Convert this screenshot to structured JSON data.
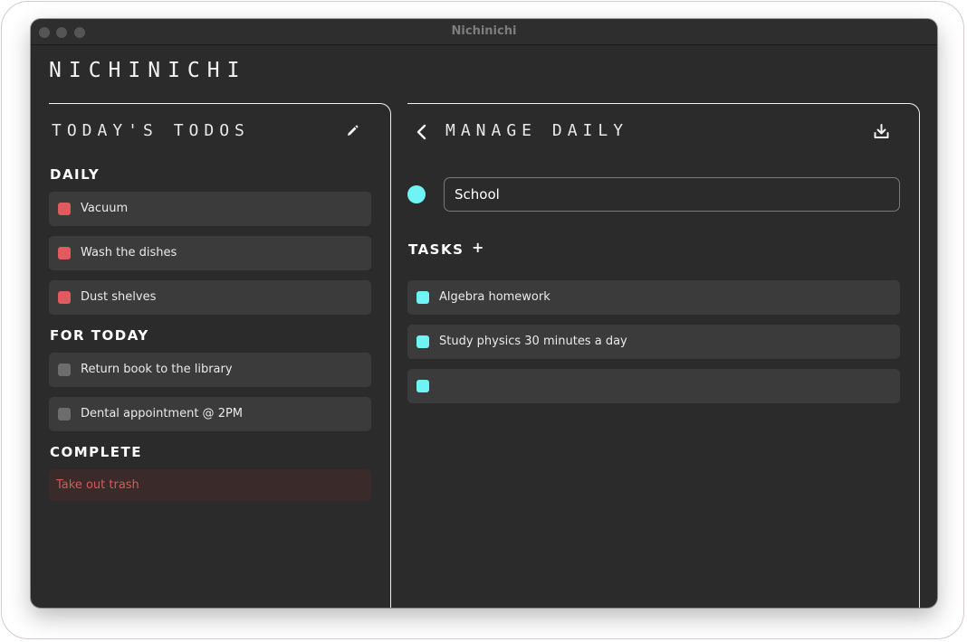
{
  "window": {
    "title": "Nichinichi"
  },
  "app": {
    "brand": "NICHINICHI"
  },
  "left": {
    "title": "TODAY'S TODOS",
    "sections": {
      "daily": {
        "label": "DAILY",
        "items": [
          "Vacuum",
          "Wash the dishes",
          "Dust shelves"
        ],
        "color": "#e05a5e"
      },
      "today": {
        "label": "FOR TODAY",
        "items": [
          "Return book to the library",
          "Dental appointment @ 2PM"
        ],
        "color": "#6d6d6d"
      },
      "complete": {
        "label": "COMPLETE",
        "items": [
          "Take out trash"
        ],
        "color": "#d8595b"
      }
    }
  },
  "right": {
    "title": "MANAGE DAILY",
    "group": {
      "name": "School",
      "color": "#6ff3f5"
    },
    "tasks_label": "TASKS",
    "add_glyph": "+",
    "tasks": [
      "Algebra homework",
      "Study physics 30 minutes a day",
      ""
    ]
  },
  "icons": {
    "edit": "pencil-icon",
    "back": "chevron-left-icon",
    "export": "download-icon",
    "add": "plus-icon"
  }
}
